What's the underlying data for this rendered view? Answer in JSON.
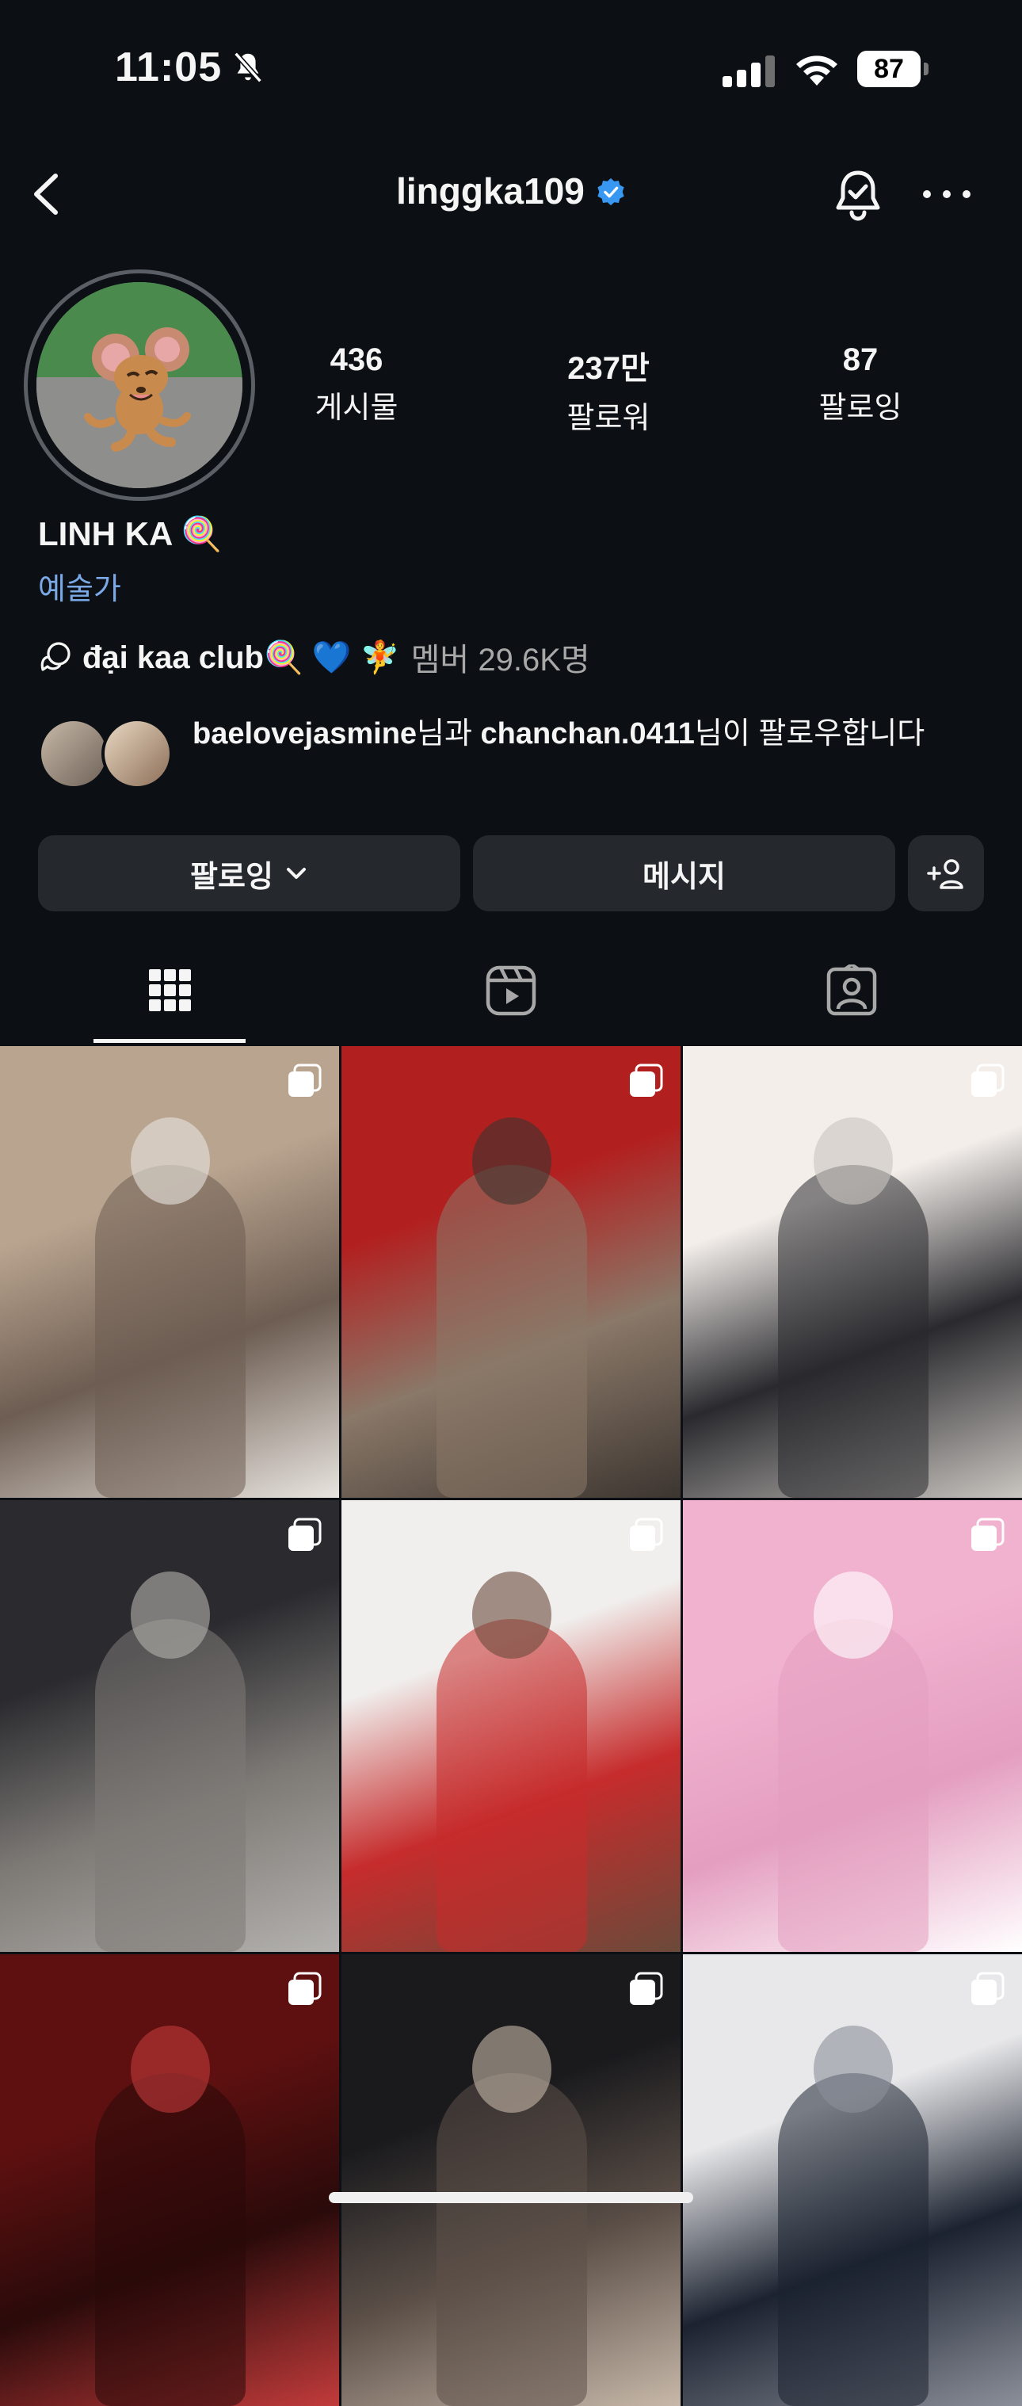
{
  "status_bar": {
    "time": "11:05",
    "battery": "87"
  },
  "header": {
    "username": "linggka109"
  },
  "profile": {
    "stats": [
      {
        "value": "436",
        "label": "게시물"
      },
      {
        "value": "237만",
        "label": "팔로워"
      },
      {
        "value": "87",
        "label": "팔로잉"
      }
    ],
    "name": "LINH KA 🍭",
    "category": "예술가",
    "channel": {
      "name": "đại kaa club🍭 💙 🧚",
      "members": "멤버 29.6K명"
    },
    "mutual": {
      "user1": "baelovejasmine",
      "mid": "님과 ",
      "user2": "chanchan.0411",
      "suffix": "님이 팔로우합니다"
    }
  },
  "actions": {
    "following_label": "팔로잉",
    "message_label": "메시지"
  },
  "tabs": [
    "posts-grid",
    "reels",
    "tagged"
  ],
  "grid": {
    "posts": [
      {
        "colors": [
          "#b9a48f",
          "#6d5d52",
          "#e8e4df"
        ]
      },
      {
        "colors": [
          "#b21f1f",
          "#8a7868",
          "#3c3530"
        ]
      },
      {
        "colors": [
          "#f3eeea",
          "#2a2a2e",
          "#c9c5c0"
        ]
      },
      {
        "colors": [
          "#2b2b2f",
          "#7d7a76",
          "#b4b2ae"
        ]
      },
      {
        "colors": [
          "#f0efed",
          "#c62c2c",
          "#6b4a3a"
        ]
      },
      {
        "colors": [
          "#f1b2cf",
          "#e49ec0",
          "#ffffff"
        ]
      },
      {
        "colors": [
          "#5e1010",
          "#2a0a0a",
          "#c23b3b"
        ]
      },
      {
        "colors": [
          "#1a1a1d",
          "#5c5048",
          "#c7b8a9"
        ]
      },
      {
        "colors": [
          "#e8e8ea",
          "#1c2330",
          "#8b8f99"
        ]
      }
    ]
  }
}
